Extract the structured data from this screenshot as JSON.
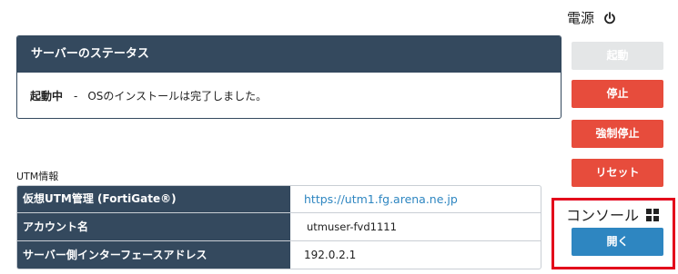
{
  "status": {
    "header": "サーバーのステータス",
    "state": "起動中",
    "separator": "-",
    "message": "OSのインストールは完了しました。"
  },
  "utm": {
    "title": "UTM情報",
    "rows": [
      {
        "key": "仮想UTM管理 (FortiGate®)",
        "value": "https://utm1.fg.arena.ne.jp"
      },
      {
        "key": "アカウント名",
        "value": "utmuser-fvd1111"
      },
      {
        "key": "サーバー側インターフェースアドレス",
        "value": "192.0.2.1"
      }
    ]
  },
  "power": {
    "title": "電源",
    "icon": "power-icon",
    "buttons": {
      "start": "起動",
      "stop": "停止",
      "force_stop": "強制停止",
      "reset": "リセット"
    }
  },
  "console": {
    "title": "コンソール",
    "icon": "windows-grid-icon",
    "open": "開く"
  },
  "colors": {
    "header_bg": "#34495e",
    "danger": "#e74c3c",
    "primary": "#2e86c1",
    "disabled": "#e4e6e7",
    "highlight_border": "#e3001b"
  }
}
